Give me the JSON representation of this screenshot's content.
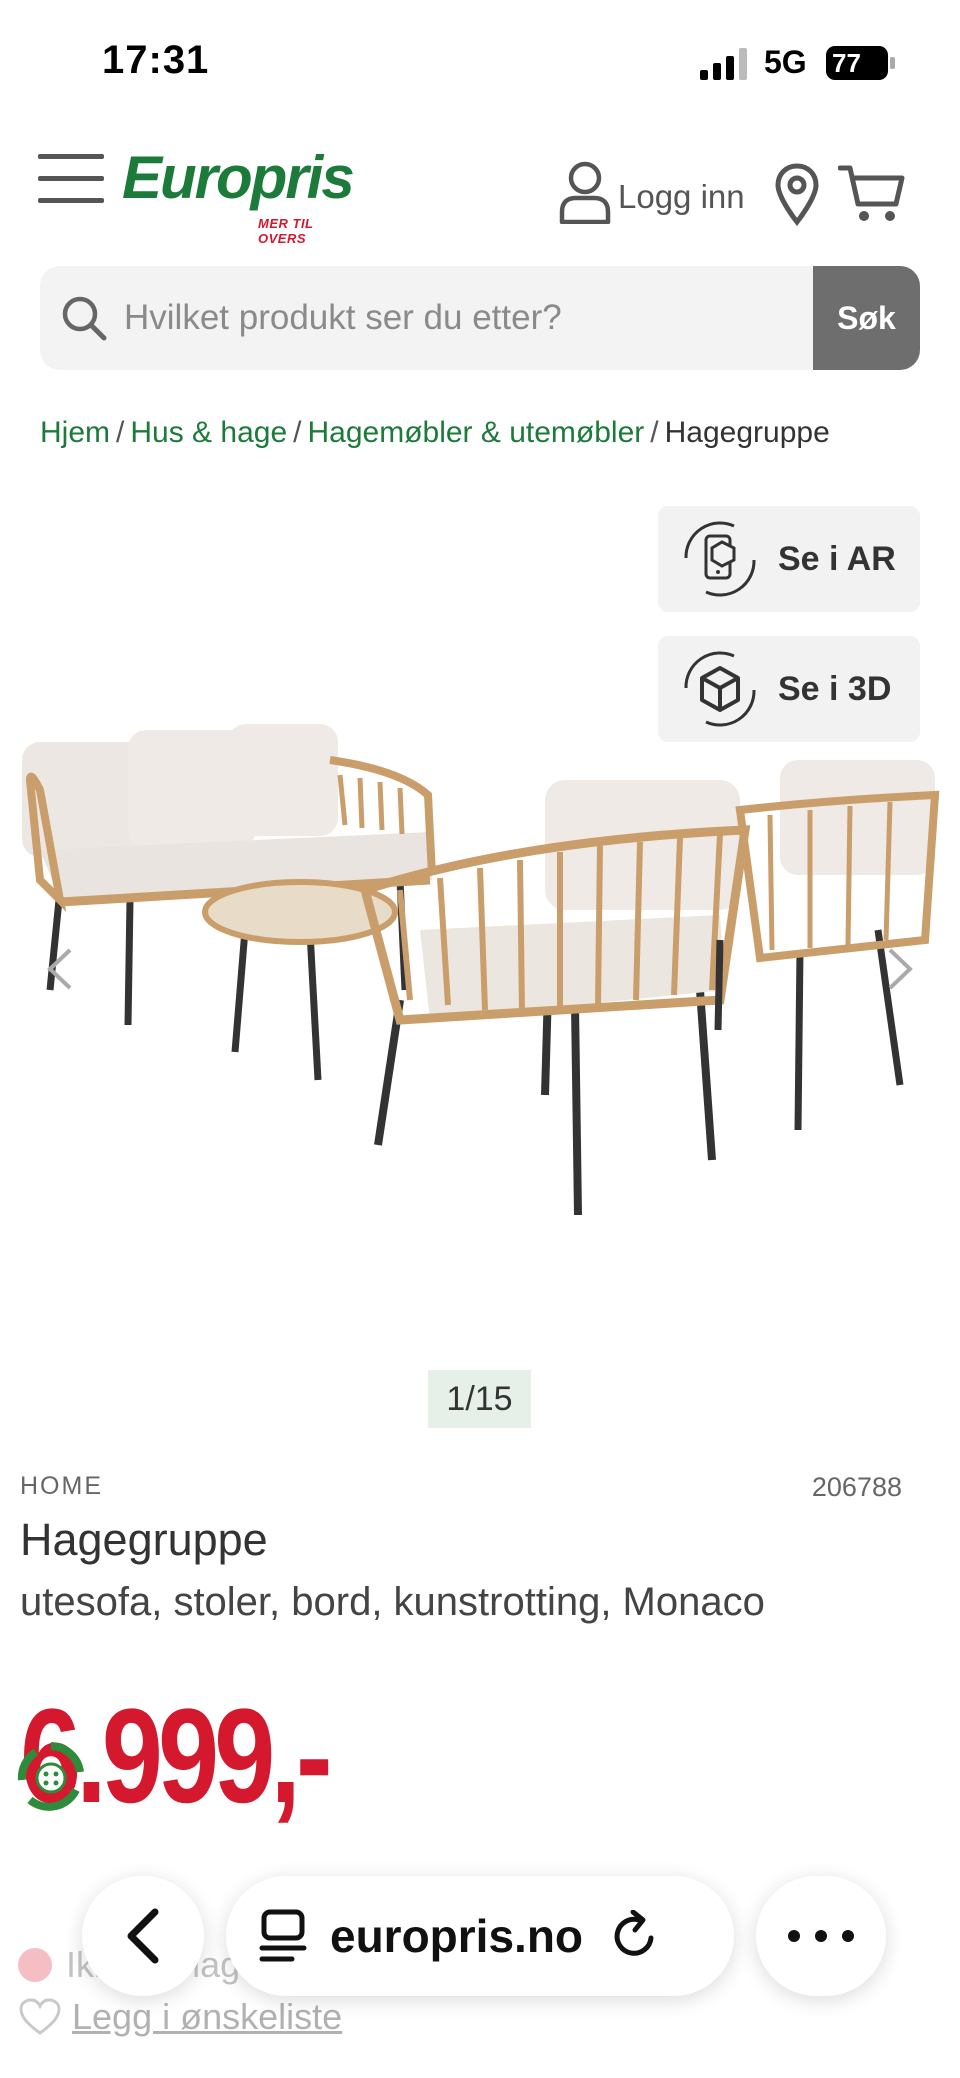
{
  "status_bar": {
    "time": "17:31",
    "network": "5G",
    "battery": "77"
  },
  "header": {
    "logo_text": "Europris",
    "logo_tagline": "MER TIL OVERS",
    "login_label": "Logg inn"
  },
  "search": {
    "placeholder": "Hvilket produkt ser du etter?",
    "button_label": "Søk"
  },
  "breadcrumb": {
    "items": [
      "Hjem",
      "Hus & hage",
      "Hagemøbler & utemøbler"
    ],
    "separator": "/",
    "current": "Hagegruppe"
  },
  "view_buttons": {
    "ar_label": "Se i AR",
    "three_d_label": "Se i 3D"
  },
  "gallery": {
    "counter": "1/15"
  },
  "product": {
    "brand": "HOME",
    "sku": "206788",
    "name": "Hagegruppe",
    "description": "utesofa, stoler, bord, kunstrotting, Monaco",
    "price": "6.999,-"
  },
  "availability": {
    "text": "Ikke på lager",
    "wishlist_label": "Legg i ønskeliste"
  },
  "browser": {
    "url": "europris.no"
  },
  "colors": {
    "brand_green": "#1c7a3a",
    "price_red": "#d4182e",
    "search_button": "#6e6e6e"
  }
}
